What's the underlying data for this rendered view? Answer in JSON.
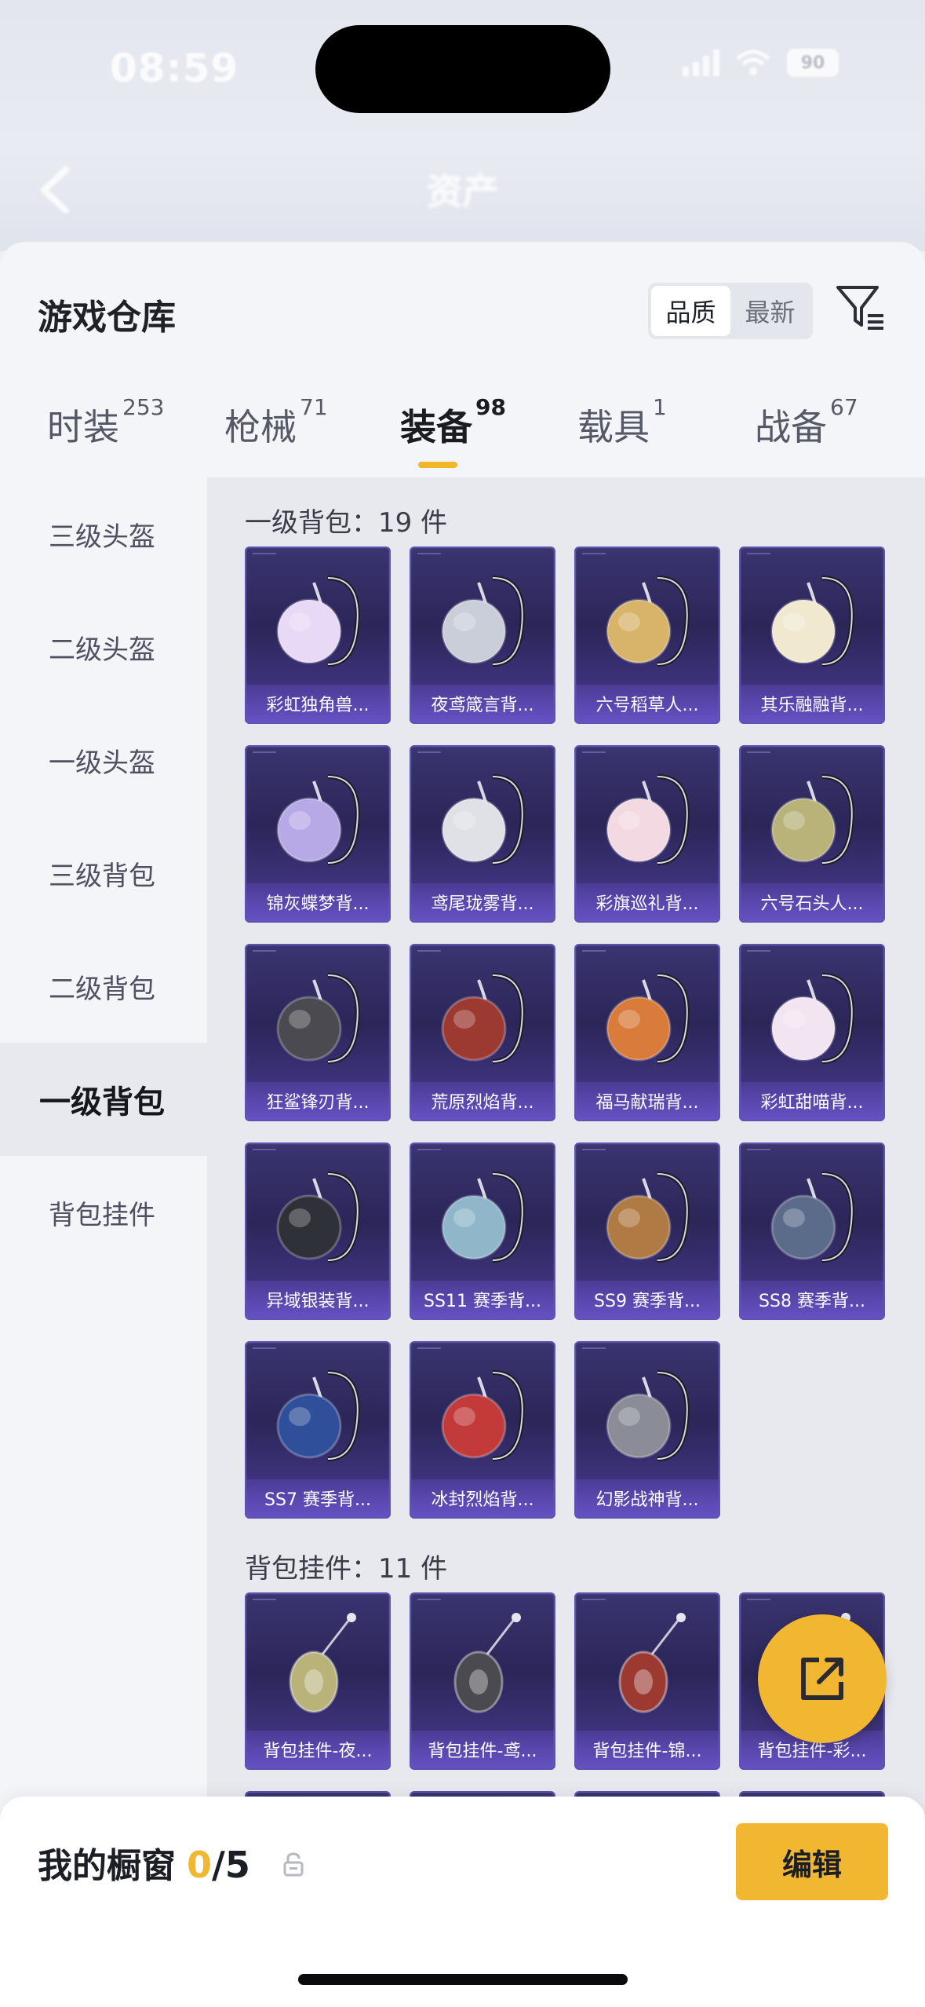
{
  "status": {
    "time": "08:59",
    "battery": "90"
  },
  "nav": {
    "title": "资产"
  },
  "sheet": {
    "title": "游戏仓库",
    "sort": {
      "options": [
        "品质",
        "最新"
      ],
      "active": "品质"
    }
  },
  "tabs": [
    {
      "label": "时装",
      "count": "253"
    },
    {
      "label": "枪械",
      "count": "71"
    },
    {
      "label": "装备",
      "count": "98",
      "active": true
    },
    {
      "label": "载具",
      "count": "1"
    },
    {
      "label": "战备",
      "count": "67"
    }
  ],
  "sidebar": {
    "items": [
      "三级头盔",
      "二级头盔",
      "一级头盔",
      "三级背包",
      "二级背包",
      "一级背包",
      "背包挂件"
    ],
    "active_index": 5
  },
  "sections": [
    {
      "title": "一级背包：19 件",
      "items": [
        {
          "label": "彩虹独角兽...",
          "icon": "unicorn-backpack-icon"
        },
        {
          "label": "夜鸢箴言背...",
          "icon": "strap-backpack-icon"
        },
        {
          "label": "六号稻草人...",
          "icon": "scarecrow-backpack-icon"
        },
        {
          "label": "其乐融融背...",
          "icon": "cream-backpack-icon"
        },
        {
          "label": "锦灰蝶梦背...",
          "icon": "butterfly-backpack-icon"
        },
        {
          "label": "鸢尾珑雾背...",
          "icon": "iris-backpack-icon"
        },
        {
          "label": "彩旗巡礼背...",
          "icon": "flag-backpack-icon"
        },
        {
          "label": "六号石头人...",
          "icon": "stone-backpack-icon"
        },
        {
          "label": "狂鲨锋刃背...",
          "icon": "shark-backpack-icon"
        },
        {
          "label": "荒原烈焰背...",
          "icon": "flame-backpack-icon"
        },
        {
          "label": "福马献瑞背...",
          "icon": "horse-backpack-icon"
        },
        {
          "label": "彩虹甜喵背...",
          "icon": "cat-backpack-icon"
        },
        {
          "label": "异域银装背...",
          "icon": "silver-backpack-icon"
        },
        {
          "label": "SS11 赛季背...",
          "icon": "season-backpack-icon"
        },
        {
          "label": "SS9 赛季背...",
          "icon": "season-backpack-icon"
        },
        {
          "label": "SS8 赛季背...",
          "icon": "season-backpack-icon"
        },
        {
          "label": "SS7 赛季背...",
          "icon": "season-backpack-icon"
        },
        {
          "label": "冰封烈焰背...",
          "icon": "ice-flame-backpack-icon"
        },
        {
          "label": "幻影战神背...",
          "icon": "phantom-backpack-icon"
        }
      ]
    },
    {
      "title": "背包挂件：11 件",
      "items": [
        {
          "label": "背包挂件-夜...",
          "icon": "pendant-icon"
        },
        {
          "label": "背包挂件-鸢...",
          "icon": "pendant-icon"
        },
        {
          "label": "背包挂件-锦...",
          "icon": "pendant-icon"
        },
        {
          "label": "背包挂件-彩...",
          "icon": "pendant-icon"
        }
      ]
    }
  ],
  "bottom": {
    "showcase_label": "我的橱窗",
    "showcase_current": "0",
    "showcase_total": "/5",
    "edit_label": "编辑"
  },
  "colors": {
    "accent": "#f2b731",
    "card_bg": "#2b2658",
    "card_border": "#5c52b0"
  }
}
